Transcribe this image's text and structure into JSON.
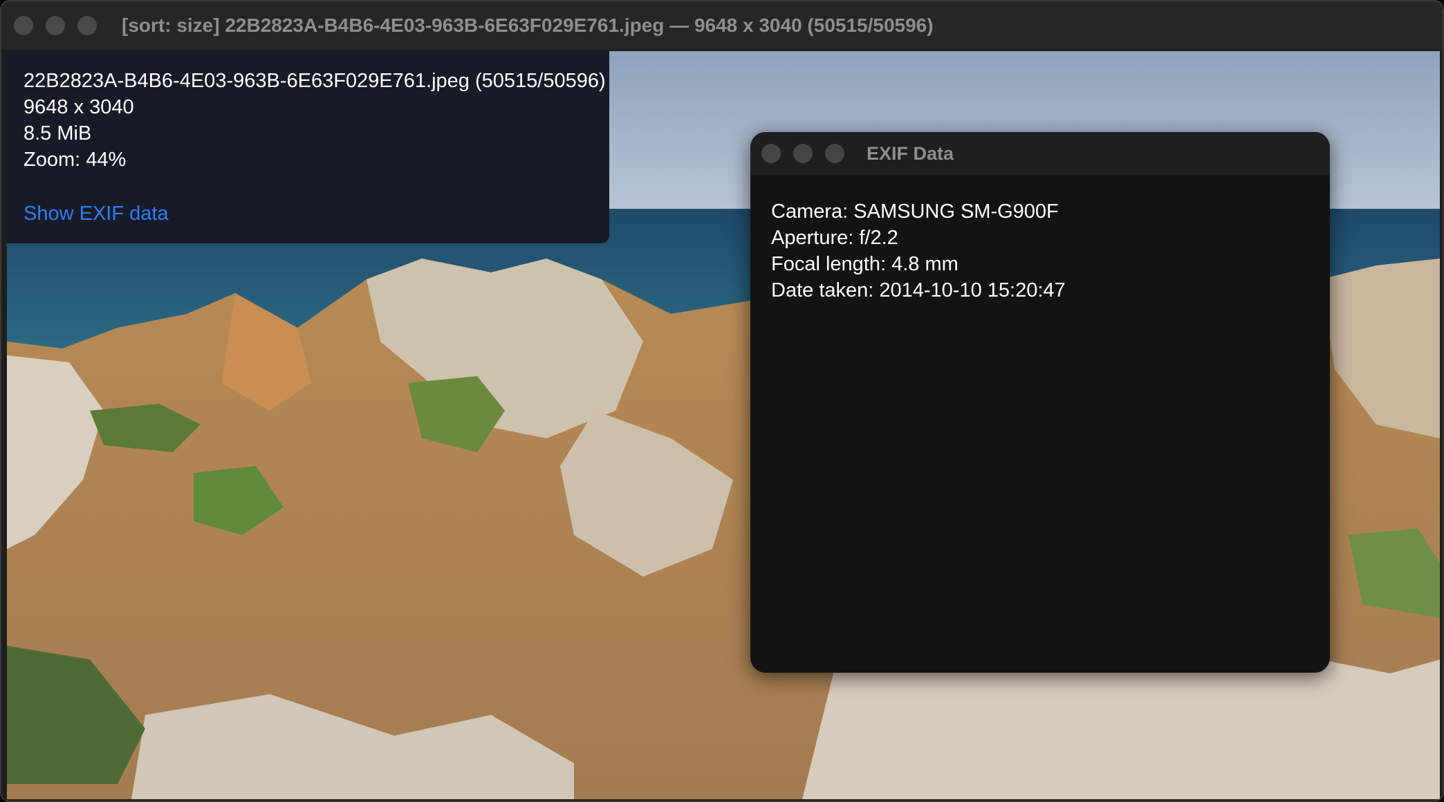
{
  "window": {
    "title": "[sort: size] 22B2823A-B4B6-4E03-963B-6E63F029E761.jpeg — 9648 x 3040  (50515/50596)"
  },
  "info_panel": {
    "filename_line": "22B2823A-B4B6-4E03-963B-6E63F029E761.jpeg  (50515/50596)",
    "dimensions": "9648 x 3040",
    "file_size": "8.5 MiB",
    "zoom": "Zoom: 44%",
    "show_exif_link": "Show EXIF data"
  },
  "exif_window": {
    "title": "EXIF Data",
    "camera": "Camera: SAMSUNG SM-G900F",
    "aperture": "Aperture: f/2.2",
    "focal_length": "Focal length: 4.8 mm",
    "date_taken": "Date taken: 2014-10-10 15:20:47"
  },
  "colors": {
    "link": "#2f7cf6",
    "panel_bg": "#161b27",
    "exif_bg": "#131313",
    "titlebar_bg": "#262626"
  },
  "icons": [
    "close-icon",
    "minimize-icon",
    "zoom-icon"
  ]
}
